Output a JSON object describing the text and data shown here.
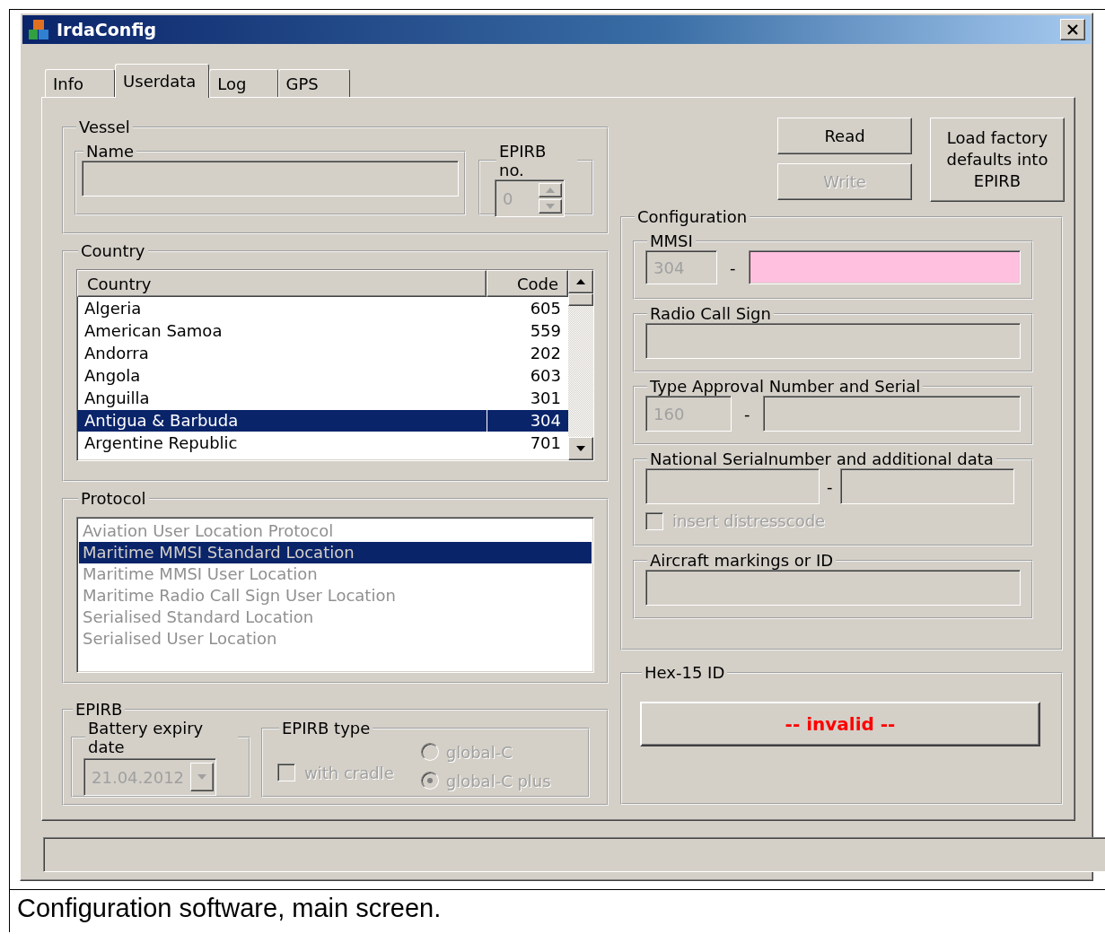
{
  "window": {
    "title": "IrdaConfig"
  },
  "tabs": [
    {
      "label": "Info",
      "selected": false
    },
    {
      "label": "Userdata",
      "selected": true
    },
    {
      "label": "Log",
      "selected": false
    },
    {
      "label": "GPS",
      "selected": false
    }
  ],
  "vessel": {
    "title": "Vessel",
    "name": {
      "label": "Name"
    },
    "epirb_no": {
      "label": "EPIRB no.",
      "value": "0"
    }
  },
  "country": {
    "title": "Country",
    "columns": [
      "Country",
      "Code"
    ],
    "rows": [
      {
        "name": "Algeria",
        "code": "605",
        "selected": false
      },
      {
        "name": "American Samoa",
        "code": "559",
        "selected": false
      },
      {
        "name": "Andorra",
        "code": "202",
        "selected": false
      },
      {
        "name": "Angola",
        "code": "603",
        "selected": false
      },
      {
        "name": "Anguilla",
        "code": "301",
        "selected": false
      },
      {
        "name": "Antigua & Barbuda",
        "code": "304",
        "selected": true
      },
      {
        "name": "Argentine Republic",
        "code": "701",
        "selected": false
      }
    ]
  },
  "protocol": {
    "title": "Protocol",
    "items": [
      {
        "label": "Aviation User Location Protocol",
        "selected": false
      },
      {
        "label": "Maritime MMSI Standard Location",
        "selected": true
      },
      {
        "label": "Maritime MMSI User Location",
        "selected": false
      },
      {
        "label": "Maritime Radio Call Sign User Location",
        "selected": false
      },
      {
        "label": "Serialised Standard Location",
        "selected": false
      },
      {
        "label": "Serialised User Location",
        "selected": false
      }
    ]
  },
  "epirb": {
    "title": "EPIRB",
    "battery": {
      "label": "Battery expiry date",
      "value": "21.04.2012"
    },
    "type": {
      "label": "EPIRB type",
      "cradle": {
        "label": "with cradle",
        "checked": false
      },
      "options": [
        {
          "label": "global-C",
          "selected": false
        },
        {
          "label": "global-C plus",
          "selected": true
        }
      ]
    }
  },
  "buttons": [
    {
      "label": "Read",
      "disabled": false
    },
    {
      "label": "Write",
      "disabled": true
    },
    {
      "label": "Load factory defaults into EPIRB",
      "disabled": false
    }
  ],
  "configuration": {
    "title": "Configuration",
    "mmsi": {
      "label": "MMSI",
      "prefix": "304",
      "separator": "-",
      "invalid": true
    },
    "radio_call_sign": {
      "label": "Radio Call Sign"
    },
    "type_approval": {
      "label": "Type Approval Number and Serial",
      "prefix": "160",
      "separator": "-"
    },
    "national": {
      "label": "National Serialnumber and additional data",
      "separator": "-",
      "checkbox": {
        "label": "insert distresscode",
        "checked": false
      }
    },
    "aircraft": {
      "label": "Aircraft markings or ID"
    }
  },
  "hex_id": {
    "title": "Hex-15 ID",
    "value": "-- invalid --"
  },
  "caption": "Configuration software, main screen."
}
